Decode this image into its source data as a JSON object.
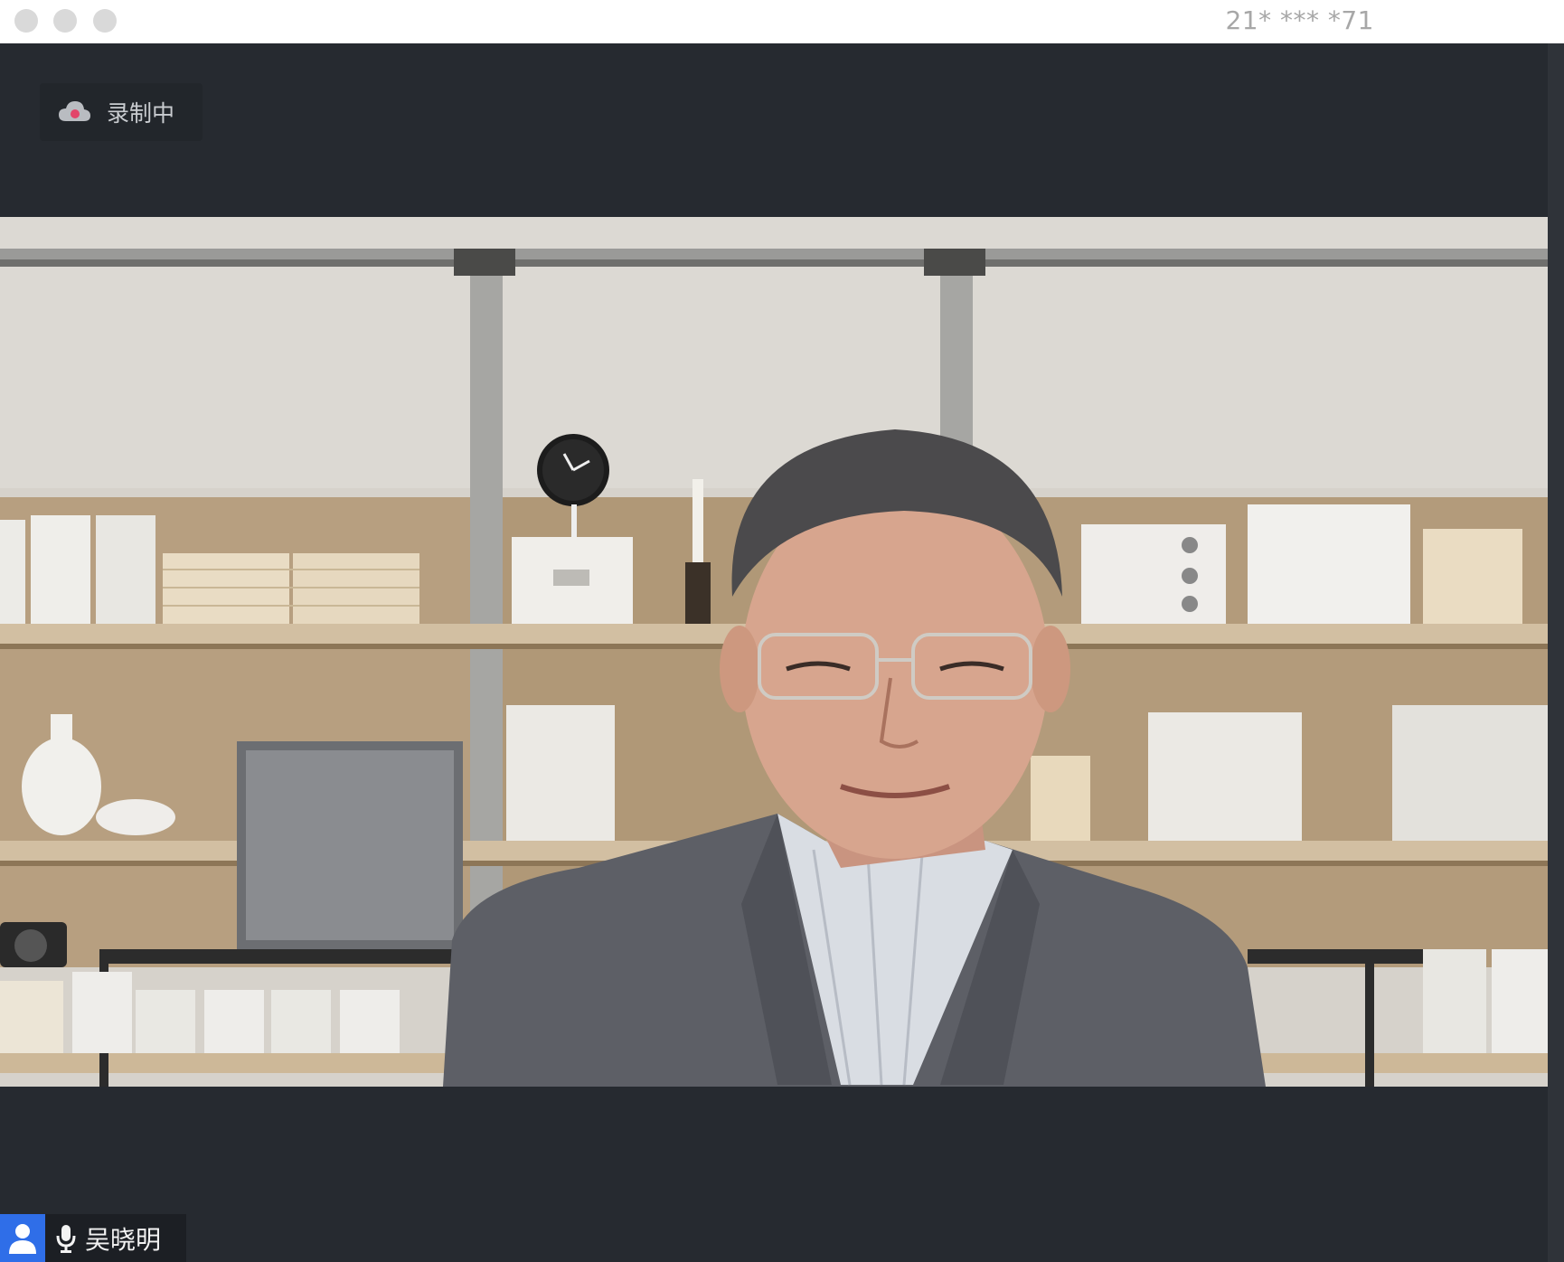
{
  "window": {
    "meeting_id": "21* *** *71"
  },
  "recording": {
    "label": "录制中"
  },
  "participant": {
    "name": "吴晓明"
  },
  "colors": {
    "stage_bg": "#262a30",
    "name_tag_accent": "#2f6ee8",
    "titlebar_bg": "#ffffff"
  },
  "icons": {
    "recording": "cloud-recording-icon",
    "participant": "user-icon",
    "microphone": "microphone-icon"
  }
}
